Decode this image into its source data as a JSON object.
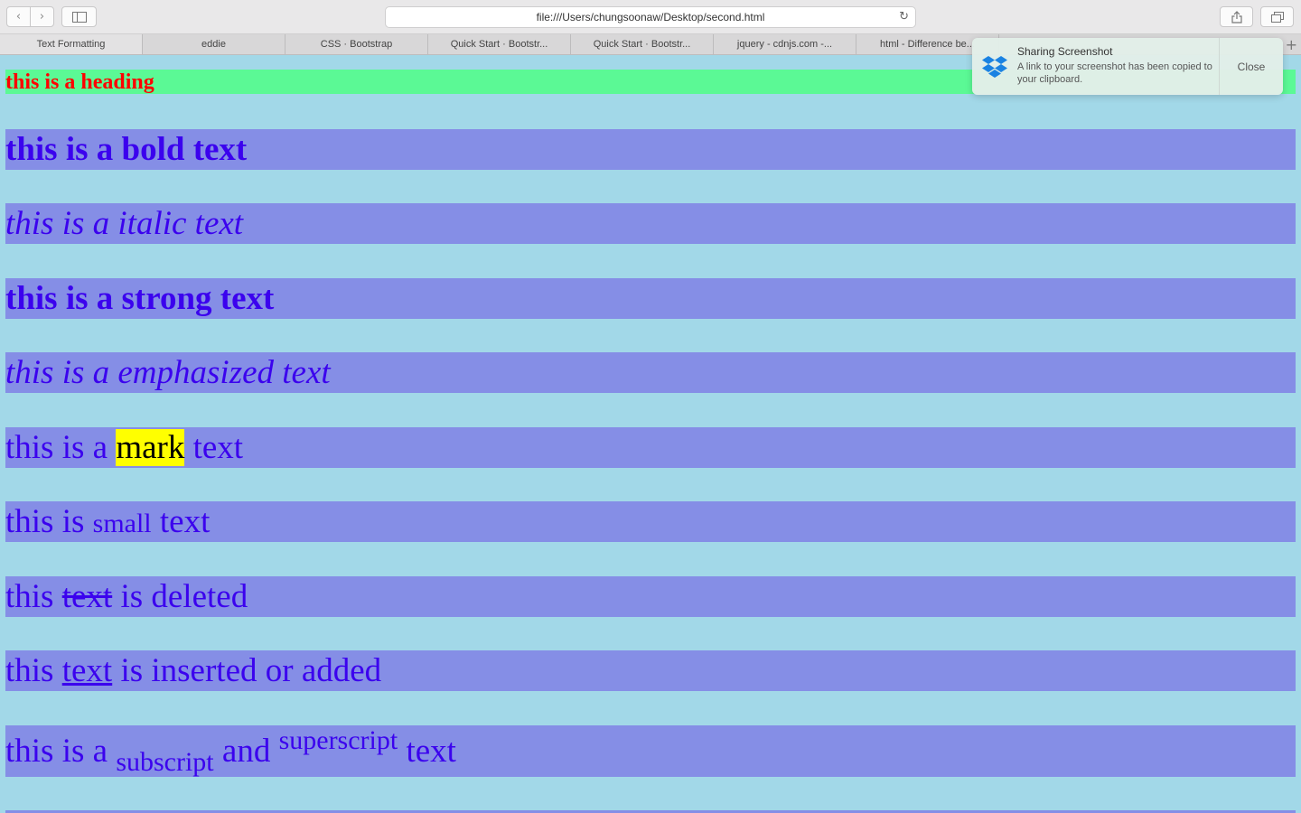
{
  "browser": {
    "url": "file:///Users/chungsoonaw/Desktop/second.html",
    "tabs": [
      {
        "label": "Text Formatting",
        "active": true
      },
      {
        "label": "eddie",
        "active": false
      },
      {
        "label": "CSS · Bootstrap",
        "active": false
      },
      {
        "label": "Quick Start · Bootstr...",
        "active": false
      },
      {
        "label": "Quick Start · Bootstr...",
        "active": false
      },
      {
        "label": "jquery - cdnjs.com -...",
        "active": false
      },
      {
        "label": "html - Difference be...",
        "active": false
      }
    ],
    "icons": {
      "back": "chevron-left-icon",
      "forward": "chevron-right-icon",
      "sidebar": "sidebar-icon",
      "reload": "reload-icon",
      "share": "share-icon",
      "tabs": "tabs-overview-icon",
      "new_tab": "plus-icon"
    }
  },
  "notification": {
    "title": "Sharing Screenshot",
    "message": "A link to your screenshot has been copied to your clipboard.",
    "close_label": "Close",
    "icon": "dropbox-icon"
  },
  "page": {
    "heading": "this is a heading",
    "bold": "this is a bold text",
    "italic": "this is a italic text",
    "strong": "this is a strong text",
    "emphasized": "this is a emphasized text",
    "mark": {
      "before": "this is a ",
      "marked": "mark",
      "after": " text"
    },
    "small": {
      "before": "this is ",
      "small": "small",
      "after": " text"
    },
    "deleted": {
      "before": "this ",
      "deleted": "text",
      "after": " is deleted"
    },
    "inserted": {
      "before": "this ",
      "inserted": "text",
      "after": " is inserted or added"
    },
    "subsup": {
      "before": "this is a ",
      "sub": "subscript",
      "middle": " and ",
      "sup": "superscript",
      "after": " text"
    }
  },
  "colors": {
    "page_background": "#a2d8e8",
    "heading_background": "#5bf995",
    "heading_text": "#ff0000",
    "line_background": "#858ee6",
    "line_text": "#3b02ee",
    "mark_background": "#ffff00"
  }
}
